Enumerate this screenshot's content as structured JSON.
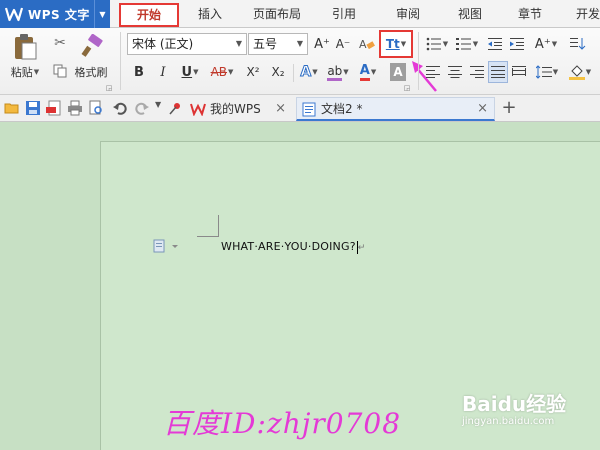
{
  "app": {
    "title": "WPS 文字",
    "menu_tabs": [
      {
        "label": "开始",
        "active": true
      },
      {
        "label": "插入"
      },
      {
        "label": "页面布局"
      },
      {
        "label": "引用"
      },
      {
        "label": "审阅"
      },
      {
        "label": "视图"
      },
      {
        "label": "章节"
      },
      {
        "label": "开发"
      }
    ]
  },
  "ribbon": {
    "paste_label": "粘贴",
    "format_painter_label": "格式刷",
    "font_name": "宋体 (正文)",
    "font_size": "五号",
    "bold": "B",
    "italic": "I",
    "underline": "U",
    "strike": "AB",
    "superscript": "X²",
    "subscript": "X₂",
    "font_color_letter": "A",
    "text_effect_letter": "A",
    "highlight_letter": "ab",
    "shade_letter": "A",
    "grow_font": "A⁺",
    "shrink_font": "A⁻",
    "change_case_label": "Tt",
    "change_case_highlight_color": "#e53935",
    "pointer_arrow_color": "#e43ad6",
    "accent_color": "#2b6cc4"
  },
  "doc_tabs": [
    {
      "label": "我的WPS"
    },
    {
      "label": "文档2 *",
      "active": true
    }
  ],
  "document": {
    "text": "WHAT·ARE·YOU·DOING?",
    "para_mark": "↵"
  },
  "watermark": {
    "text": "百度ID:zhjr0708",
    "baidu_logo": "Baidu经验",
    "baidu_url": "jingyan.baidu.com"
  }
}
